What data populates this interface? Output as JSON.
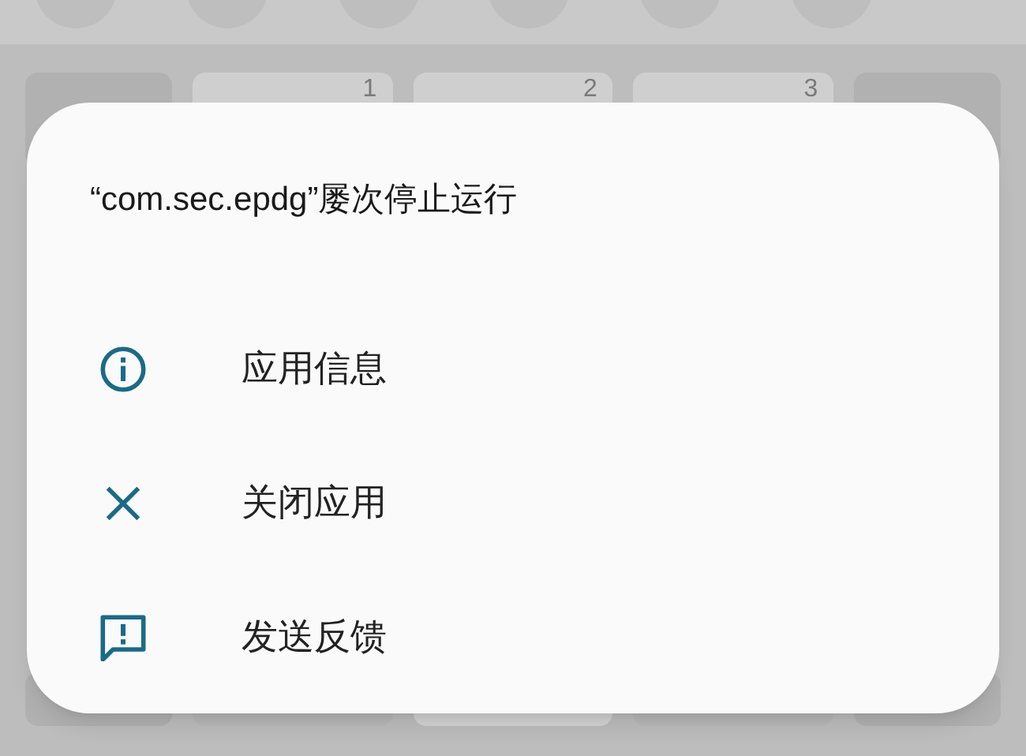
{
  "keyboard": {
    "keys": [
      {
        "kind": "function"
      },
      {
        "label": "1",
        "kind": "digit"
      },
      {
        "label": "2",
        "kind": "digit"
      },
      {
        "label": "3",
        "kind": "digit"
      },
      {
        "kind": "function"
      }
    ]
  },
  "dialog": {
    "title": "“com.sec.epdg”屡次停止运行",
    "items": [
      {
        "label": "应用信息",
        "kind": "info"
      },
      {
        "label": "关闭应用",
        "kind": "close"
      },
      {
        "label": "发送反馈",
        "kind": "feedback"
      }
    ]
  }
}
